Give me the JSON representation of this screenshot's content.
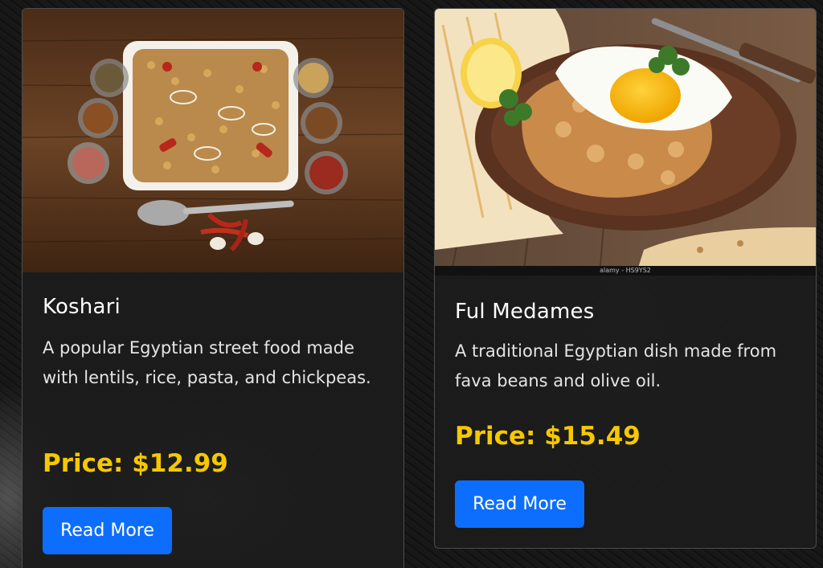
{
  "cards": [
    {
      "title": "Koshari",
      "description": "A popular Egyptian street food made with lentils, rice, pasta, and chickpeas.",
      "price": "Price: $12.99",
      "button_label": "Read More",
      "image": "koshari-photo"
    },
    {
      "title": "Ful Medames",
      "description": "A traditional Egyptian dish made from fava beans and olive oil.",
      "price": "Price: $15.49",
      "button_label": "Read More",
      "image": "ful-medames-photo",
      "image_watermark": "alamy - HS9YS2"
    }
  ],
  "colors": {
    "price": "#f5c800",
    "button": "#0d6efd",
    "card_background": "#1c1c1c"
  }
}
